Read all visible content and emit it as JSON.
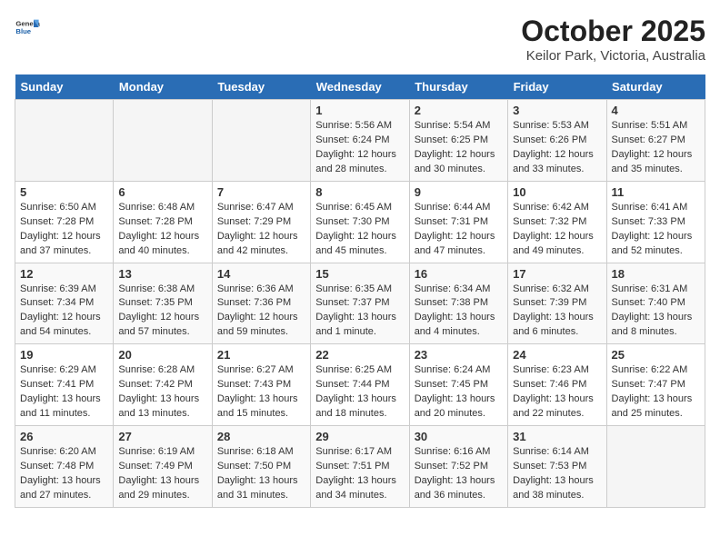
{
  "header": {
    "logo_general": "General",
    "logo_blue": "Blue",
    "month": "October 2025",
    "location": "Keilor Park, Victoria, Australia"
  },
  "days_of_week": [
    "Sunday",
    "Monday",
    "Tuesday",
    "Wednesday",
    "Thursday",
    "Friday",
    "Saturday"
  ],
  "weeks": [
    [
      {
        "day": "",
        "empty": true
      },
      {
        "day": "",
        "empty": true
      },
      {
        "day": "",
        "empty": true
      },
      {
        "day": "1",
        "sunrise": "5:56 AM",
        "sunset": "6:24 PM",
        "daylight": "12 hours and 28 minutes."
      },
      {
        "day": "2",
        "sunrise": "5:54 AM",
        "sunset": "6:25 PM",
        "daylight": "12 hours and 30 minutes."
      },
      {
        "day": "3",
        "sunrise": "5:53 AM",
        "sunset": "6:26 PM",
        "daylight": "12 hours and 33 minutes."
      },
      {
        "day": "4",
        "sunrise": "5:51 AM",
        "sunset": "6:27 PM",
        "daylight": "12 hours and 35 minutes."
      }
    ],
    [
      {
        "day": "5",
        "sunrise": "6:50 AM",
        "sunset": "7:28 PM",
        "daylight": "12 hours and 37 minutes."
      },
      {
        "day": "6",
        "sunrise": "6:48 AM",
        "sunset": "7:28 PM",
        "daylight": "12 hours and 40 minutes."
      },
      {
        "day": "7",
        "sunrise": "6:47 AM",
        "sunset": "7:29 PM",
        "daylight": "12 hours and 42 minutes."
      },
      {
        "day": "8",
        "sunrise": "6:45 AM",
        "sunset": "7:30 PM",
        "daylight": "12 hours and 45 minutes."
      },
      {
        "day": "9",
        "sunrise": "6:44 AM",
        "sunset": "7:31 PM",
        "daylight": "12 hours and 47 minutes."
      },
      {
        "day": "10",
        "sunrise": "6:42 AM",
        "sunset": "7:32 PM",
        "daylight": "12 hours and 49 minutes."
      },
      {
        "day": "11",
        "sunrise": "6:41 AM",
        "sunset": "7:33 PM",
        "daylight": "12 hours and 52 minutes."
      }
    ],
    [
      {
        "day": "12",
        "sunrise": "6:39 AM",
        "sunset": "7:34 PM",
        "daylight": "12 hours and 54 minutes."
      },
      {
        "day": "13",
        "sunrise": "6:38 AM",
        "sunset": "7:35 PM",
        "daylight": "12 hours and 57 minutes."
      },
      {
        "day": "14",
        "sunrise": "6:36 AM",
        "sunset": "7:36 PM",
        "daylight": "12 hours and 59 minutes."
      },
      {
        "day": "15",
        "sunrise": "6:35 AM",
        "sunset": "7:37 PM",
        "daylight": "13 hours and 1 minute."
      },
      {
        "day": "16",
        "sunrise": "6:34 AM",
        "sunset": "7:38 PM",
        "daylight": "13 hours and 4 minutes."
      },
      {
        "day": "17",
        "sunrise": "6:32 AM",
        "sunset": "7:39 PM",
        "daylight": "13 hours and 6 minutes."
      },
      {
        "day": "18",
        "sunrise": "6:31 AM",
        "sunset": "7:40 PM",
        "daylight": "13 hours and 8 minutes."
      }
    ],
    [
      {
        "day": "19",
        "sunrise": "6:29 AM",
        "sunset": "7:41 PM",
        "daylight": "13 hours and 11 minutes."
      },
      {
        "day": "20",
        "sunrise": "6:28 AM",
        "sunset": "7:42 PM",
        "daylight": "13 hours and 13 minutes."
      },
      {
        "day": "21",
        "sunrise": "6:27 AM",
        "sunset": "7:43 PM",
        "daylight": "13 hours and 15 minutes."
      },
      {
        "day": "22",
        "sunrise": "6:25 AM",
        "sunset": "7:44 PM",
        "daylight": "13 hours and 18 minutes."
      },
      {
        "day": "23",
        "sunrise": "6:24 AM",
        "sunset": "7:45 PM",
        "daylight": "13 hours and 20 minutes."
      },
      {
        "day": "24",
        "sunrise": "6:23 AM",
        "sunset": "7:46 PM",
        "daylight": "13 hours and 22 minutes."
      },
      {
        "day": "25",
        "sunrise": "6:22 AM",
        "sunset": "7:47 PM",
        "daylight": "13 hours and 25 minutes."
      }
    ],
    [
      {
        "day": "26",
        "sunrise": "6:20 AM",
        "sunset": "7:48 PM",
        "daylight": "13 hours and 27 minutes."
      },
      {
        "day": "27",
        "sunrise": "6:19 AM",
        "sunset": "7:49 PM",
        "daylight": "13 hours and 29 minutes."
      },
      {
        "day": "28",
        "sunrise": "6:18 AM",
        "sunset": "7:50 PM",
        "daylight": "13 hours and 31 minutes."
      },
      {
        "day": "29",
        "sunrise": "6:17 AM",
        "sunset": "7:51 PM",
        "daylight": "13 hours and 34 minutes."
      },
      {
        "day": "30",
        "sunrise": "6:16 AM",
        "sunset": "7:52 PM",
        "daylight": "13 hours and 36 minutes."
      },
      {
        "day": "31",
        "sunrise": "6:14 AM",
        "sunset": "7:53 PM",
        "daylight": "13 hours and 38 minutes."
      },
      {
        "day": "",
        "empty": true
      }
    ]
  ],
  "labels": {
    "sunrise": "Sunrise:",
    "sunset": "Sunset:",
    "daylight": "Daylight:"
  }
}
